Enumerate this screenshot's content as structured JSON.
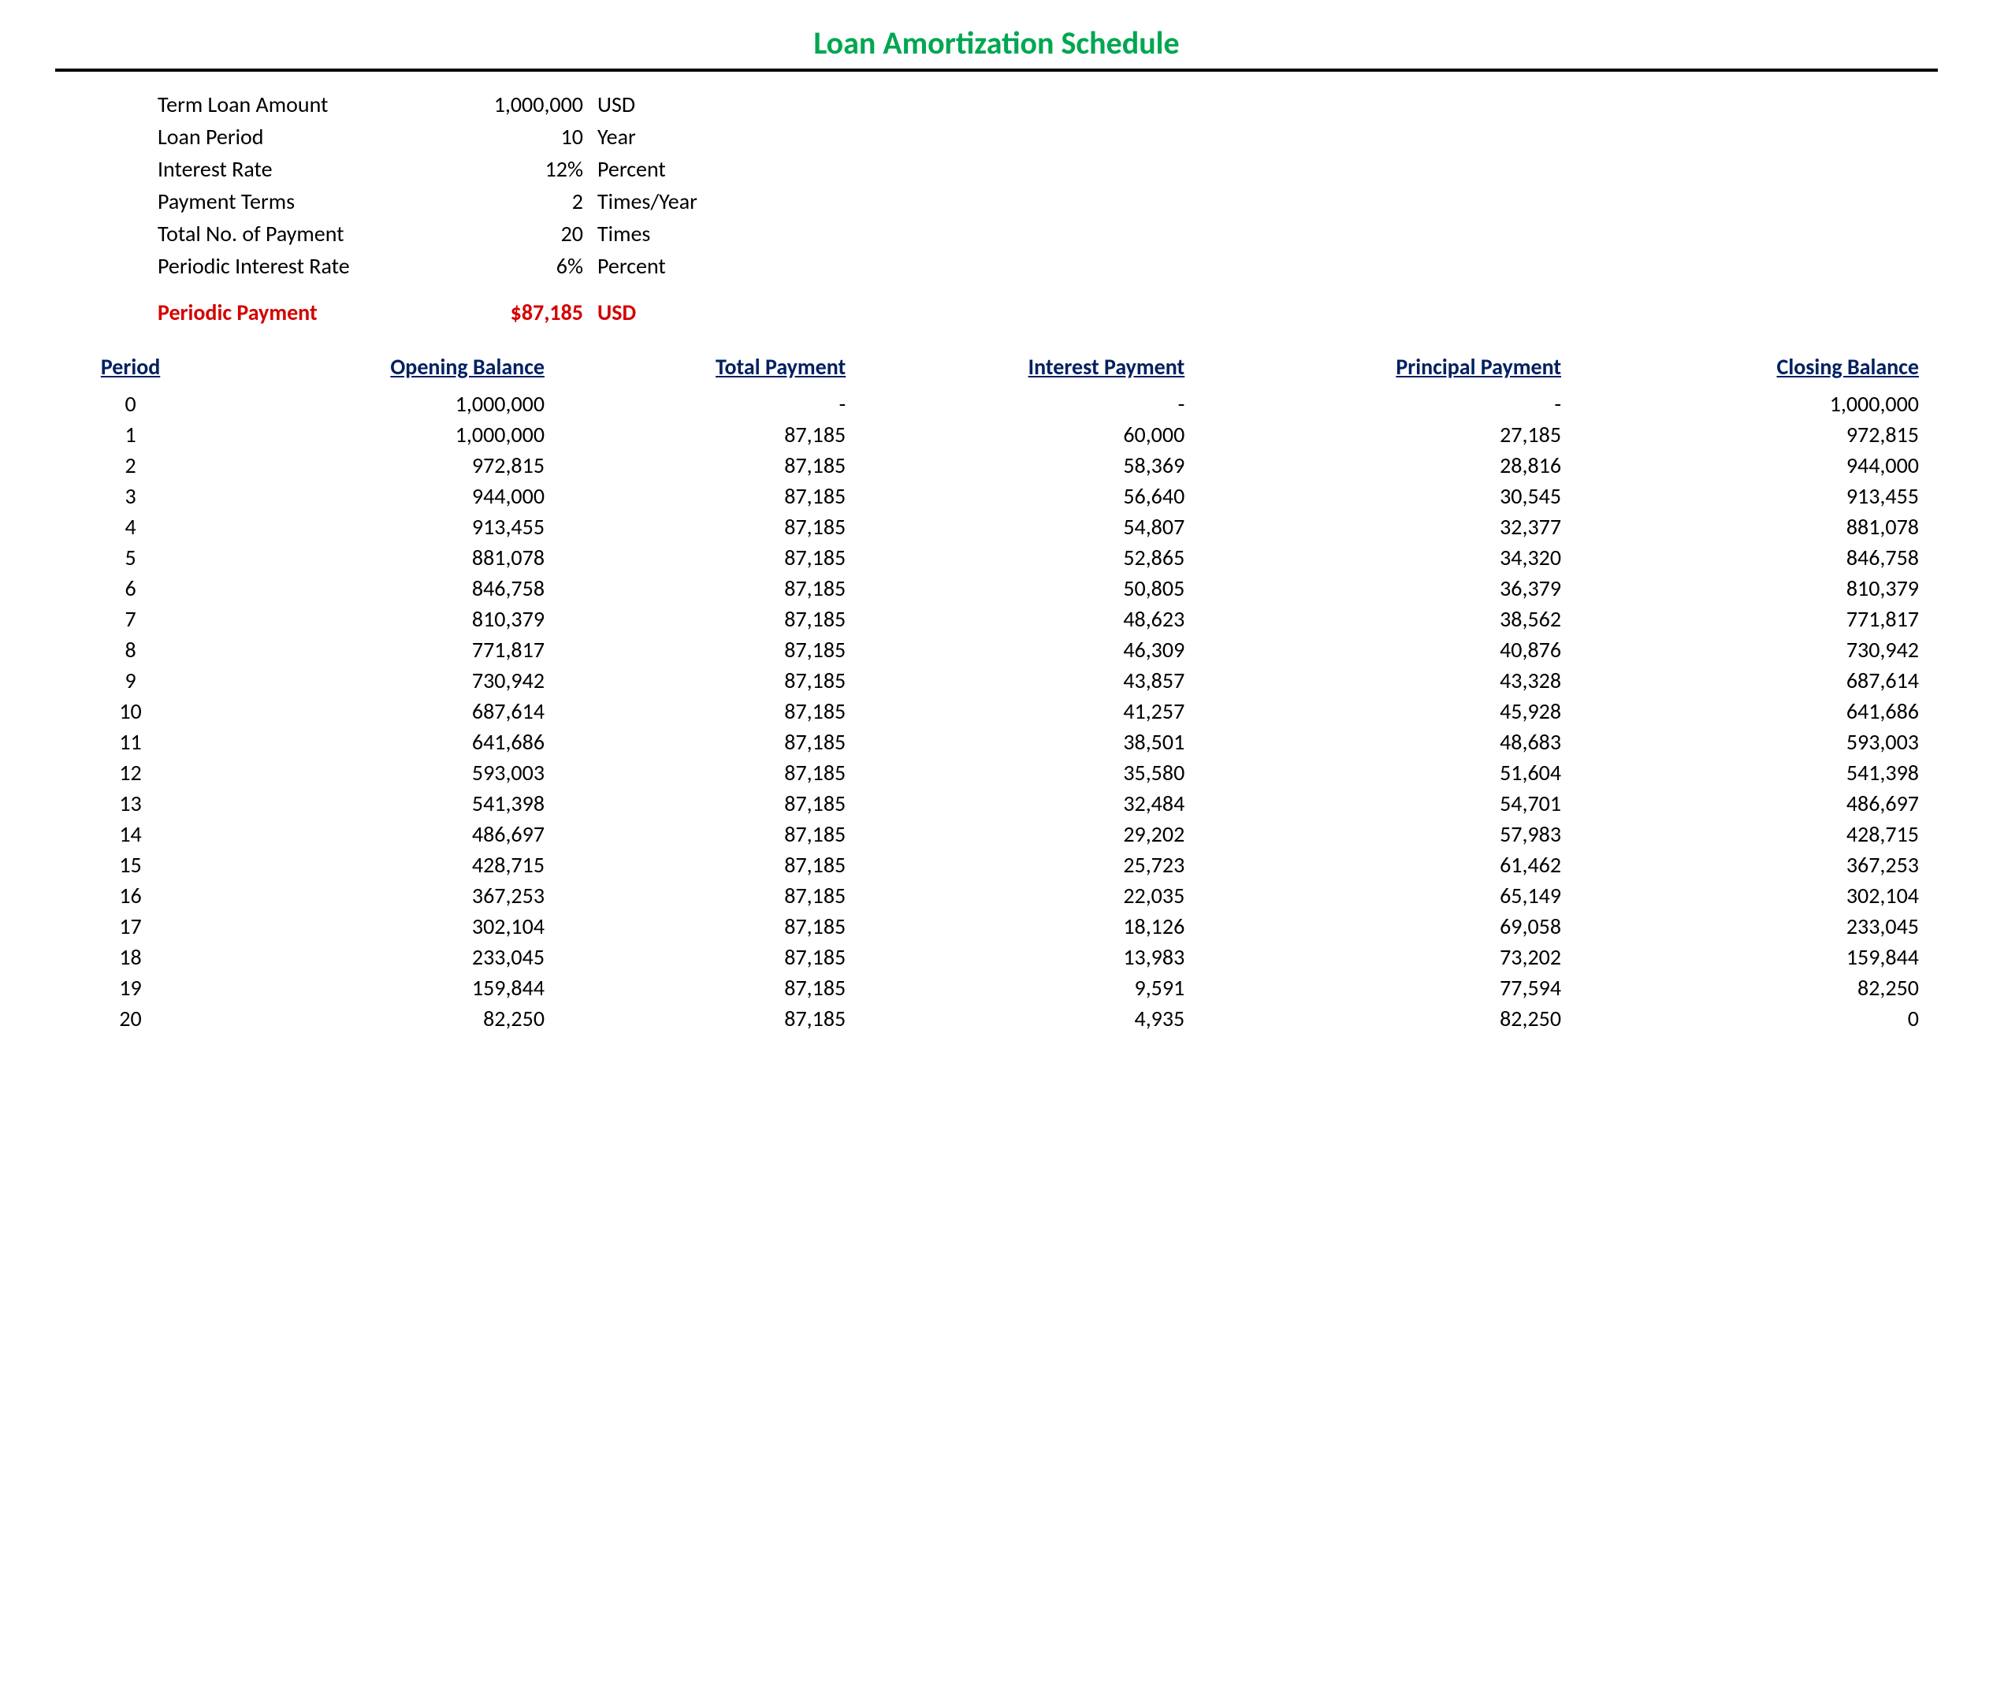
{
  "title": "Loan Amortization Schedule",
  "summary": [
    {
      "label": "Term Loan Amount",
      "value": "1,000,000",
      "unit": "USD"
    },
    {
      "label": "Loan Period",
      "value": "10",
      "unit": "Year"
    },
    {
      "label": "Interest Rate",
      "value": "12%",
      "unit": "Percent"
    },
    {
      "label": "Payment Terms",
      "value": "2",
      "unit": "Times/Year"
    },
    {
      "label": "Total No. of Payment",
      "value": "20",
      "unit": "Times"
    },
    {
      "label": "Periodic Interest Rate",
      "value": "6%",
      "unit": "Percent"
    }
  ],
  "periodic_payment": {
    "label": "Periodic Payment",
    "value": "$87,185",
    "unit": "USD"
  },
  "table": {
    "headers": {
      "period": "Period",
      "opening": "Opening Balance",
      "total": "Total Payment",
      "interest": "Interest Payment",
      "principal": "Principal Payment",
      "closing": "Closing Balance"
    },
    "rows": [
      {
        "period": "0",
        "opening": "1,000,000",
        "total": "-",
        "interest": "-",
        "principal": "-",
        "closing": "1,000,000"
      },
      {
        "period": "1",
        "opening": "1,000,000",
        "total": "87,185",
        "interest": "60,000",
        "principal": "27,185",
        "closing": "972,815"
      },
      {
        "period": "2",
        "opening": "972,815",
        "total": "87,185",
        "interest": "58,369",
        "principal": "28,816",
        "closing": "944,000"
      },
      {
        "period": "3",
        "opening": "944,000",
        "total": "87,185",
        "interest": "56,640",
        "principal": "30,545",
        "closing": "913,455"
      },
      {
        "period": "4",
        "opening": "913,455",
        "total": "87,185",
        "interest": "54,807",
        "principal": "32,377",
        "closing": "881,078"
      },
      {
        "period": "5",
        "opening": "881,078",
        "total": "87,185",
        "interest": "52,865",
        "principal": "34,320",
        "closing": "846,758"
      },
      {
        "period": "6",
        "opening": "846,758",
        "total": "87,185",
        "interest": "50,805",
        "principal": "36,379",
        "closing": "810,379"
      },
      {
        "period": "7",
        "opening": "810,379",
        "total": "87,185",
        "interest": "48,623",
        "principal": "38,562",
        "closing": "771,817"
      },
      {
        "period": "8",
        "opening": "771,817",
        "total": "87,185",
        "interest": "46,309",
        "principal": "40,876",
        "closing": "730,942"
      },
      {
        "period": "9",
        "opening": "730,942",
        "total": "87,185",
        "interest": "43,857",
        "principal": "43,328",
        "closing": "687,614"
      },
      {
        "period": "10",
        "opening": "687,614",
        "total": "87,185",
        "interest": "41,257",
        "principal": "45,928",
        "closing": "641,686"
      },
      {
        "period": "11",
        "opening": "641,686",
        "total": "87,185",
        "interest": "38,501",
        "principal": "48,683",
        "closing": "593,003"
      },
      {
        "period": "12",
        "opening": "593,003",
        "total": "87,185",
        "interest": "35,580",
        "principal": "51,604",
        "closing": "541,398"
      },
      {
        "period": "13",
        "opening": "541,398",
        "total": "87,185",
        "interest": "32,484",
        "principal": "54,701",
        "closing": "486,697"
      },
      {
        "period": "14",
        "opening": "486,697",
        "total": "87,185",
        "interest": "29,202",
        "principal": "57,983",
        "closing": "428,715"
      },
      {
        "period": "15",
        "opening": "428,715",
        "total": "87,185",
        "interest": "25,723",
        "principal": "61,462",
        "closing": "367,253"
      },
      {
        "period": "16",
        "opening": "367,253",
        "total": "87,185",
        "interest": "22,035",
        "principal": "65,149",
        "closing": "302,104"
      },
      {
        "period": "17",
        "opening": "302,104",
        "total": "87,185",
        "interest": "18,126",
        "principal": "69,058",
        "closing": "233,045"
      },
      {
        "period": "18",
        "opening": "233,045",
        "total": "87,185",
        "interest": "13,983",
        "principal": "73,202",
        "closing": "159,844"
      },
      {
        "period": "19",
        "opening": "159,844",
        "total": "87,185",
        "interest": "9,591",
        "principal": "77,594",
        "closing": "82,250"
      },
      {
        "period": "20",
        "opening": "82,250",
        "total": "87,185",
        "interest": "4,935",
        "principal": "82,250",
        "closing": "0"
      }
    ]
  }
}
